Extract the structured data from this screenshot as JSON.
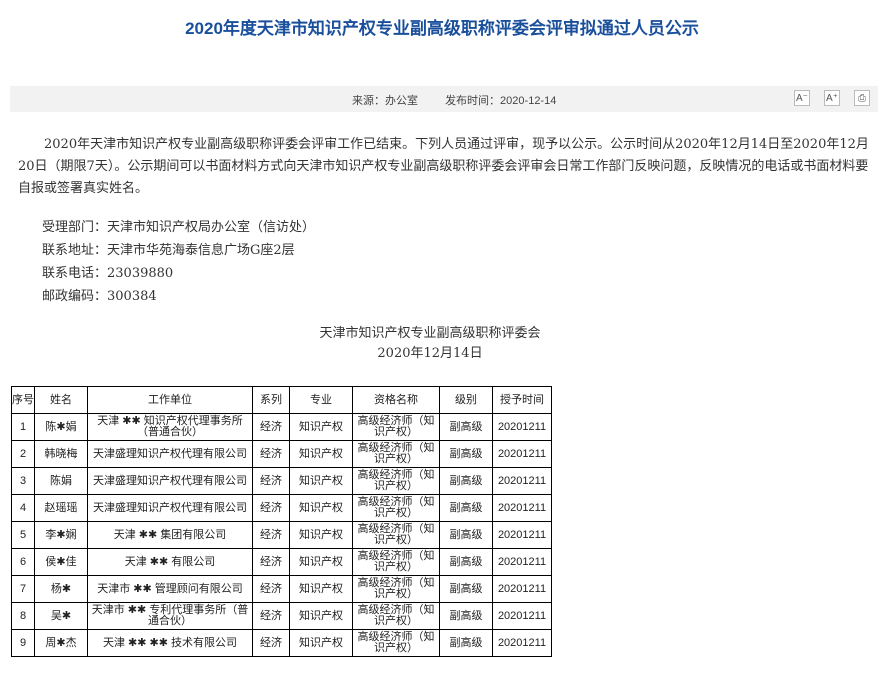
{
  "page": {
    "title": "2020年度天津市知识产权专业副高级职称评委会评审拟通过人员公示",
    "source": "来源：办公室",
    "publish_time": "发布时间：2020-12-14",
    "tools": {
      "font_smaller": "A⁻",
      "font_larger": "A⁺",
      "print": "⎙"
    }
  },
  "notice": {
    "paragraph": "2020年天津市知识产权专业副高级职称评委会评审工作已结束。下列人员通过评审，现予以公示。公示时间从2020年12月14日至2020年12月20日（期限7天）。公示期间可以书面材料方式向天津市知识产权专业副高级职称评委会评审会日常工作部门反映问题，反映情况的电话或书面材料要自报或签署真实姓名。",
    "contact": [
      "受理部门：天津市知识产权局办公室（信访处）",
      "联系地址：天津市华苑海泰信息广场G座2层",
      "联系电话：23039880",
      "邮政编码：300384"
    ],
    "signature": "天津市知识产权专业副高级职称评委会",
    "date": "2020年12月14日"
  },
  "table": {
    "headers": [
      "序号",
      "姓名",
      "工作单位",
      "系列",
      "专业",
      "资格名称",
      "级别",
      "授予时间"
    ],
    "rows": [
      [
        "1",
        "陈✱娟",
        "天津  ✱✱  知识产权代理事务所（普通合伙）",
        "经济",
        "知识产权",
        "高级经济师（知识产权）",
        "副高级",
        "20201211"
      ],
      [
        "2",
        "韩晓梅",
        "天津盛理知识产权代理有限公司",
        "经济",
        "知识产权",
        "高级经济师（知识产权）",
        "副高级",
        "20201211"
      ],
      [
        "3",
        "陈娟",
        "天津盛理知识产权代理有限公司",
        "经济",
        "知识产权",
        "高级经济师（知识产权）",
        "副高级",
        "20201211"
      ],
      [
        "4",
        "赵瑶瑶",
        "天津盛理知识产权代理有限公司",
        "经济",
        "知识产权",
        "高级经济师（知识产权）",
        "副高级",
        "20201211"
      ],
      [
        "5",
        "李✱娴",
        "天津  ✱✱  集团有限公司",
        "经济",
        "知识产权",
        "高级经济师（知识产权）",
        "副高级",
        "20201211"
      ],
      [
        "6",
        "侯✱佳",
        "天津  ✱✱  有限公司",
        "经济",
        "知识产权",
        "高级经济师（知识产权）",
        "副高级",
        "20201211"
      ],
      [
        "7",
        "杨✱",
        "天津市  ✱✱  管理顾问有限公司",
        "经济",
        "知识产权",
        "高级经济师（知识产权）",
        "副高级",
        "20201211"
      ],
      [
        "8",
        "吴✱",
        "天津市  ✱✱  专利代理事务所（普通合伙）",
        "经济",
        "知识产权",
        "高级经济师（知识产权）",
        "副高级",
        "20201211"
      ],
      [
        "9",
        "周✱杰",
        "天津  ✱✱  ✱✱  技术有限公司",
        "经济",
        "知识产权",
        "高级经济师（知识产权）",
        "副高级",
        "20201211"
      ]
    ]
  }
}
